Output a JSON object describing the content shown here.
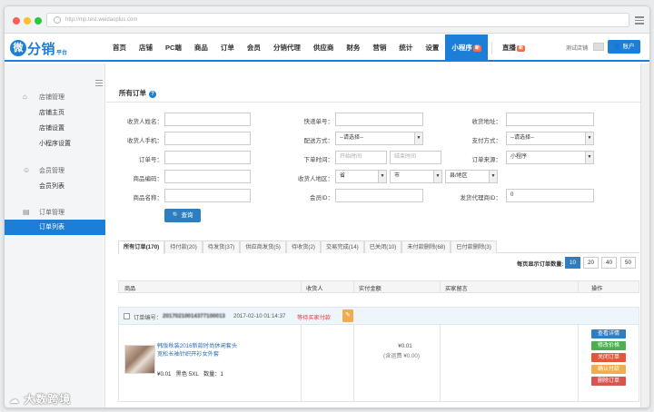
{
  "browser": {
    "url": "http://mp.test.weidaoplus.com",
    "dot_colors": [
      "#ff5f57",
      "#ffbd2e",
      "#28c840"
    ]
  },
  "brand": {
    "logo_mark": "微",
    "logo_text": "分销",
    "logo_sub": "平台",
    "accent": "#1c7ed6"
  },
  "nav": {
    "items": [
      {
        "label": "首页"
      },
      {
        "label": "店铺"
      },
      {
        "label": "PC端"
      },
      {
        "label": "商品"
      },
      {
        "label": "订单"
      },
      {
        "label": "会员"
      },
      {
        "label": "分销代理"
      },
      {
        "label": "供应商"
      },
      {
        "label": "财务"
      },
      {
        "label": "营销"
      },
      {
        "label": "统计"
      },
      {
        "label": "设置"
      },
      {
        "label": "小程序",
        "badge": "新",
        "active": true
      }
    ],
    "live": {
      "label": "直播",
      "badge": "新"
    },
    "account_label": "测试店铺",
    "user_button": "账户"
  },
  "sidebar": {
    "sections": [
      {
        "label": "店铺管理",
        "icon": "home-icon",
        "items": [
          "店铺主页",
          "店铺设置",
          "小程序设置"
        ]
      },
      {
        "label": "会员管理",
        "icon": "users-icon",
        "items": [
          "会员列表"
        ]
      },
      {
        "label": "订单管理",
        "icon": "order-icon",
        "items": [
          "订单列表"
        ]
      }
    ],
    "active_item": "订单列表"
  },
  "page": {
    "title": "所有订单"
  },
  "filters": {
    "receiver_name": {
      "label": "收货人姓名：",
      "value": ""
    },
    "receiver_phone": {
      "label": "收货人手机：",
      "value": ""
    },
    "order_no": {
      "label": "订单号：",
      "value": ""
    },
    "product_code": {
      "label": "商品编码：",
      "value": ""
    },
    "product_name": {
      "label": "商品名称：",
      "value": ""
    },
    "express_no": {
      "label": "快递单号：",
      "value": ""
    },
    "delivery_method": {
      "label": "配送方式：",
      "value": "--请选择--"
    },
    "order_time": {
      "label": "下单时间：",
      "start_placeholder": "开始时间",
      "end_placeholder": "结束时间"
    },
    "receiver_region": {
      "label": "收货人地区：",
      "province": "省",
      "city": "市",
      "district": "县/地区"
    },
    "member_id": {
      "label": "会员ID：",
      "value": ""
    },
    "receiver_address": {
      "label": "收货地址：",
      "value": ""
    },
    "payment_method": {
      "label": "支付方式：",
      "value": "--请选择--"
    },
    "order_source": {
      "label": "订单来源：",
      "value": "小程序"
    },
    "agent_id": {
      "label": "发货代理商ID：",
      "value": "0"
    },
    "search_button": "查询"
  },
  "tabs": [
    {
      "label": "所有订单(170)",
      "active": true
    },
    {
      "label": "待付款(20)"
    },
    {
      "label": "待发货(37)"
    },
    {
      "label": "供应商发货(5)"
    },
    {
      "label": "待收货(2)"
    },
    {
      "label": "交易完成(14)"
    },
    {
      "label": "已关闭(10)"
    },
    {
      "label": "未付款删除(68)"
    },
    {
      "label": "已付款删除(3)"
    }
  ],
  "page_size": {
    "label": "每页显示订单数量:",
    "options": [
      "10",
      "20",
      "40",
      "50"
    ],
    "selected": "10"
  },
  "table": {
    "columns": [
      "商品",
      "收货人",
      "实付金额",
      "买家留言",
      "操作"
    ]
  },
  "order": {
    "no_label": "订单编号：",
    "no_value": "20170210014377100013",
    "time": "2017-02-10 01:14:37",
    "status": "等待买家付款",
    "status_color": "#e4393c",
    "product_name": "韩版秋装2016新款时尚休闲套头宽松长袖针织开衫女外套",
    "price": "¥0.01",
    "spec": "黑色 5XL",
    "qty": "数量：1",
    "paid_amount": "¥0.01",
    "freight": "(含运费 ¥0.00)",
    "actions": [
      {
        "label": "查看详情",
        "color": "#2f7ec1"
      },
      {
        "label": "修改价格",
        "color": "#4caf50"
      },
      {
        "label": "关闭订单",
        "color": "#e4553c"
      },
      {
        "label": "确认付款",
        "color": "#f0ad4e"
      },
      {
        "label": "删除订单",
        "color": "#d9534f"
      }
    ]
  },
  "watermark": "大数跨境"
}
